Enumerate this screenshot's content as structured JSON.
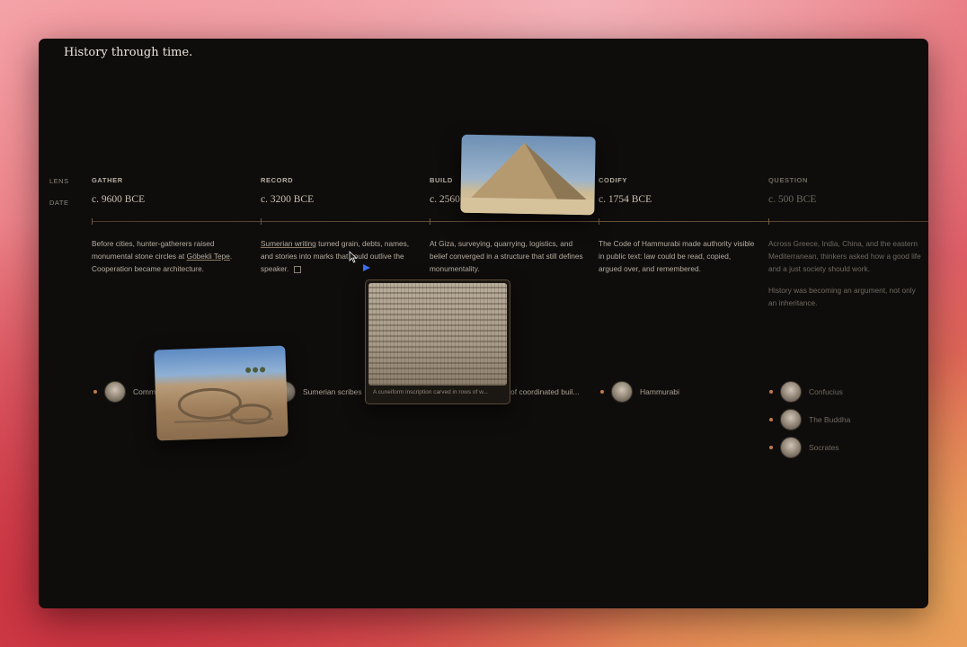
{
  "window_title": "History through time.",
  "row_labels": {
    "lens": "LENS",
    "date": "DATE"
  },
  "columns": [
    {
      "lens": "GATHER",
      "date": "c. 9600 BCE",
      "body": {
        "before": "Before cities, hunter-gatherers raised monumental stone circles at ",
        "link": "Göbekli Tepe",
        "after": ". Cooperation became architecture."
      }
    },
    {
      "lens": "RECORD",
      "date": "c. 3200 BCE",
      "body": {
        "link": "Sumerian writing",
        "after": " turned grain, debts, names, and stories into marks that could outlive the speaker."
      }
    },
    {
      "lens": "BUILD",
      "date": "c. 2560",
      "body": {
        "text": "At Giza, surveying, quarrying, logistics, and belief converged in a structure that still defines monumentality."
      }
    },
    {
      "lens": "CODIFY",
      "date": "c. 1754 BCE",
      "body": {
        "text": "The Code of Hammurabi made authority visible in public text: law could be read, copied, argued over, and remembered."
      }
    },
    {
      "lens": "QUESTION",
      "date": "c. 500 BCE",
      "body": {
        "text": "Across Greece, India, China, and the eastern Mediterranean, thinkers asked how a good life and a just society should work.",
        "text2": "History was becoming an argument, not only an inheritance."
      }
    }
  ],
  "people": [
    {
      "name": "Comm"
    },
    {
      "name": "Sumerian scribes"
    },
    {
      "name": "of coordinated buil..."
    },
    {
      "name": "Hammurabi"
    },
    {
      "name": "Confucius"
    },
    {
      "name": "The Buddha"
    },
    {
      "name": "Socrates"
    }
  ],
  "cards": {
    "cuneiform_caption": "A cuneiform inscription carved in rows of w..."
  },
  "colors": {
    "window_bg": "#0f0d0c",
    "accent_dot": "#c17a4a",
    "cursor": "#3a6df0"
  }
}
